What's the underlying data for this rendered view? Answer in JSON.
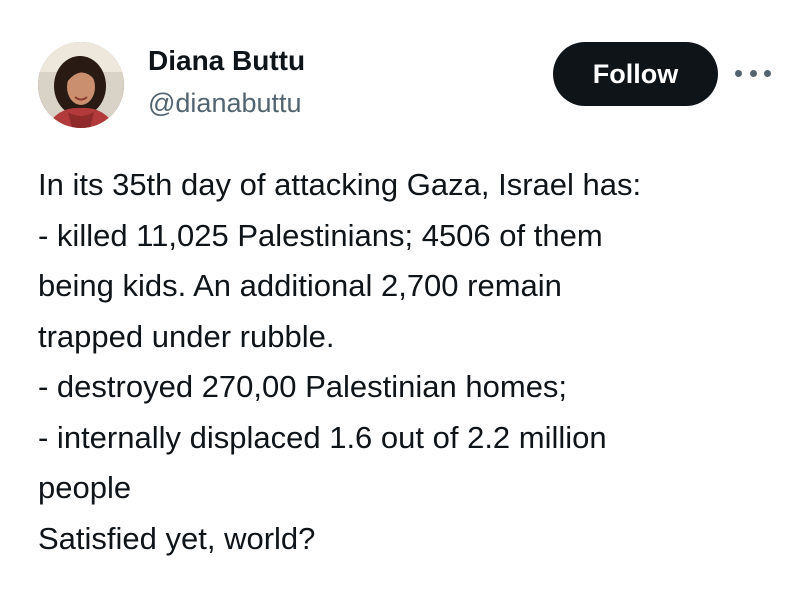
{
  "author": {
    "display_name": "Diana Buttu",
    "handle": "@dianabuttu",
    "avatar_icon": "profile-photo"
  },
  "actions": {
    "follow_label": "Follow",
    "more_icon": "more-options-icon"
  },
  "tweet": {
    "lines": [
      "In its 35th day of attacking Gaza, Israel has:",
      "- killed 11,025 Palestinians; 4506 of them",
      "being kids. An additional 2,700 remain",
      "trapped under rubble.",
      "- destroyed 270,00 Palestinian homes;",
      "- internally displaced 1.6 out of 2.2 million",
      "people",
      "Satisfied yet, world?"
    ]
  },
  "colors": {
    "text_primary": "#0f1419",
    "text_secondary": "#536471",
    "button_bg": "#0f1419",
    "background": "#ffffff"
  }
}
